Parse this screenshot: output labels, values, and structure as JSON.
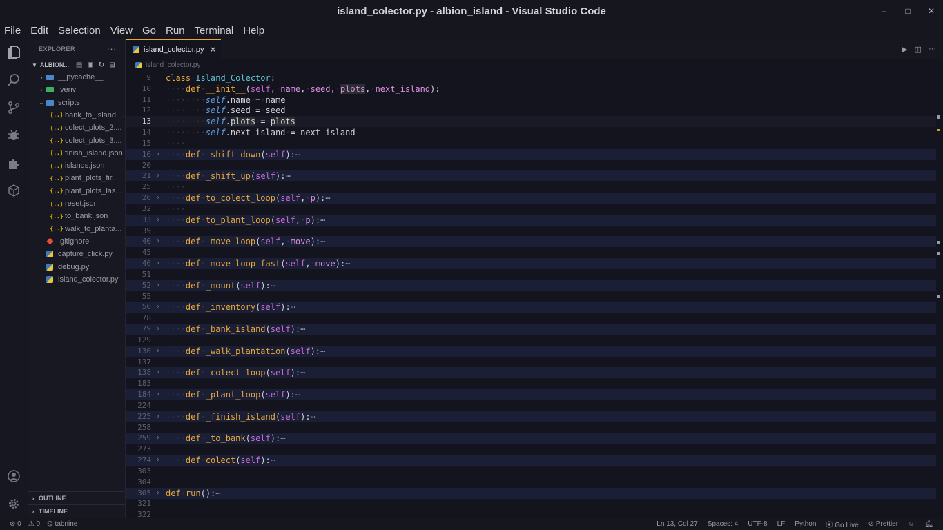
{
  "window": {
    "title": "island_colector.py - albion_island - Visual Studio Code",
    "minimize": "–",
    "maximize": "□",
    "close": "✕"
  },
  "menu": [
    "File",
    "Edit",
    "Selection",
    "View",
    "Go",
    "Run",
    "Terminal",
    "Help"
  ],
  "explorer": {
    "header": "EXPLORER",
    "more": "···",
    "folder": "ALBION...",
    "items": [
      {
        "label": "__pycache__",
        "type": "folder",
        "depth": 1
      },
      {
        "label": ".venv",
        "type": "folder",
        "depth": 1
      },
      {
        "label": "scripts",
        "type": "folder-open",
        "depth": 1
      },
      {
        "label": "bank_to_island....",
        "type": "json",
        "depth": 2
      },
      {
        "label": "colect_plots_2....",
        "type": "json",
        "depth": 2
      },
      {
        "label": "colect_plots_3....",
        "type": "json",
        "depth": 2
      },
      {
        "label": "finish_island.json",
        "type": "json",
        "depth": 2
      },
      {
        "label": "islands.json",
        "type": "json",
        "depth": 2
      },
      {
        "label": "plant_plots_fir...",
        "type": "json",
        "depth": 2
      },
      {
        "label": "plant_plots_las...",
        "type": "json",
        "depth": 2
      },
      {
        "label": "reset.json",
        "type": "json",
        "depth": 2
      },
      {
        "label": "to_bank.json",
        "type": "json",
        "depth": 2
      },
      {
        "label": "walk_to_planta...",
        "type": "json",
        "depth": 2
      },
      {
        "label": ".gitignore",
        "type": "git",
        "depth": 1
      },
      {
        "label": "capture_click.py",
        "type": "py",
        "depth": 1
      },
      {
        "label": "debug.py",
        "type": "py",
        "depth": 1
      },
      {
        "label": "island_colector.py",
        "type": "py",
        "depth": 1
      }
    ],
    "outline": "OUTLINE",
    "timeline": "TIMELINE"
  },
  "tab": {
    "label": "island_colector.py",
    "close": "✕"
  },
  "breadcrumb": "island_colector.py",
  "editor": {
    "lines": [
      {
        "n": "9",
        "html": "<span class='kw'>class</span><span class='w'>·</span><span class='cls'>Island_Colector</span><span class='pl'>:</span>"
      },
      {
        "n": "10",
        "html": "<span class='w'>····</span><span class='kw'>def</span><span class='w'>·</span><span class='fn'>__init__</span><span class='pl'>(</span><span class='slf'>self</span><span class='pl'>,</span><span class='w'>·</span><span class='prm'>name</span><span class='pl'>,</span><span class='w'>·</span><span class='prm'>seed</span><span class='pl'>,</span><span class='w'>·</span><span class='prm hlword'>plots</span><span class='pl'>,</span><span class='w'>·</span><span class='prm'>next_island</span><span class='pl'>):</span>"
      },
      {
        "n": "11",
        "html": "<span class='w'>········</span><span class='it'>self</span><span class='pl'>.name</span><span class='w'>·</span><span class='pl'>=</span><span class='w'>·</span><span class='pl'>name</span>"
      },
      {
        "n": "12",
        "html": "<span class='w'>········</span><span class='it'>self</span><span class='pl'>.seed</span><span class='w'>·</span><span class='pl'>=</span><span class='w'>·</span><span class='pl'>seed</span>"
      },
      {
        "n": "13",
        "cur": true,
        "html": "<span class='w'>········</span><span class='it'>self</span><span class='pl'>.</span><span class='pl hlword'>plots</span><span class='w'>·</span><span class='pl'>=</span><span class='w'>·</span><span class='pl hlword'>plots</span>"
      },
      {
        "n": "14",
        "html": "<span class='w'>········</span><span class='it'>self</span><span class='pl'>.next_island</span><span class='w'>·</span><span class='pl'>=</span><span class='w'>·</span><span class='pl'>next_island</span>"
      },
      {
        "n": "15",
        "html": "<span class='w'>····</span>"
      },
      {
        "n": "16",
        "fold": true,
        "hl": true,
        "html": "<span class='w'>····</span><span class='kw'>def</span><span class='w'>·</span><span class='fn'>_shift_down</span><span class='pl'>(</span><span class='slf'>self</span><span class='pl'>):</span><span class='ell'>⋯</span>"
      },
      {
        "n": "20",
        "html": ""
      },
      {
        "n": "21",
        "fold": true,
        "hl": true,
        "html": "<span class='w'>····</span><span class='kw'>def</span><span class='w'>·</span><span class='fn'>_shift_up</span><span class='pl'>(</span><span class='slf'>self</span><span class='pl'>):</span><span class='ell'>⋯</span>"
      },
      {
        "n": "25",
        "html": "<span class='w'>····</span>"
      },
      {
        "n": "26",
        "fold": true,
        "hl": true,
        "html": "<span class='w'>····</span><span class='kw'>def</span><span class='w'>·</span><span class='fn'>to_colect_loop</span><span class='pl'>(</span><span class='slf'>self</span><span class='pl'>,</span><span class='w'>·</span><span class='prm'>p</span><span class='pl'>):</span><span class='ell'>⋯</span>"
      },
      {
        "n": "32",
        "html": "<span class='w'>····</span>"
      },
      {
        "n": "33",
        "fold": true,
        "hl": true,
        "html": "<span class='w'>····</span><span class='kw'>def</span><span class='w'>·</span><span class='fn'>to_plant_loop</span><span class='pl'>(</span><span class='slf'>self</span><span class='pl'>,</span><span class='w'>·</span><span class='prm'>p</span><span class='pl'>):</span><span class='ell'>⋯</span>"
      },
      {
        "n": "39",
        "html": ""
      },
      {
        "n": "40",
        "fold": true,
        "hl": true,
        "html": "<span class='w'>····</span><span class='kw'>def</span><span class='w'>·</span><span class='fn'>_move_loop</span><span class='pl'>(</span><span class='slf'>self</span><span class='pl'>,</span><span class='w'>·</span><span class='prm'>move</span><span class='pl'>):</span><span class='ell'>⋯</span>"
      },
      {
        "n": "45",
        "html": ""
      },
      {
        "n": "46",
        "fold": true,
        "hl": true,
        "html": "<span class='w'>····</span><span class='kw'>def</span><span class='w'>·</span><span class='fn'>_move_loop_fast</span><span class='pl'>(</span><span class='slf'>self</span><span class='pl'>,</span><span class='w'>·</span><span class='prm'>move</span><span class='pl'>):</span><span class='ell'>⋯</span>"
      },
      {
        "n": "51",
        "html": ""
      },
      {
        "n": "52",
        "fold": true,
        "hl": true,
        "html": "<span class='w'>····</span><span class='kw'>def</span><span class='w'>·</span><span class='fn'>_mount</span><span class='pl'>(</span><span class='slf'>self</span><span class='pl'>):</span><span class='ell'>⋯</span>"
      },
      {
        "n": "55",
        "html": ""
      },
      {
        "n": "56",
        "fold": true,
        "hl": true,
        "html": "<span class='w'>····</span><span class='kw'>def</span><span class='w'>·</span><span class='fn'>_inventory</span><span class='pl'>(</span><span class='slf'>self</span><span class='pl'>):</span><span class='ell'>⋯</span>"
      },
      {
        "n": "78",
        "html": ""
      },
      {
        "n": "79",
        "fold": true,
        "hl": true,
        "html": "<span class='w'>····</span><span class='kw'>def</span><span class='w'>·</span><span class='fn'>_bank_island</span><span class='pl'>(</span><span class='slf'>self</span><span class='pl'>):</span><span class='ell'>⋯</span>"
      },
      {
        "n": "129",
        "html": ""
      },
      {
        "n": "130",
        "fold": true,
        "hl": true,
        "html": "<span class='w'>····</span><span class='kw'>def</span><span class='w'>·</span><span class='fn'>_walk_plantation</span><span class='pl'>(</span><span class='slf'>self</span><span class='pl'>):</span><span class='ell'>⋯</span>"
      },
      {
        "n": "137",
        "html": ""
      },
      {
        "n": "138",
        "fold": true,
        "hl": true,
        "html": "<span class='w'>····</span><span class='kw'>def</span><span class='w'>·</span><span class='fn'>_colect_loop</span><span class='pl'>(</span><span class='slf'>self</span><span class='pl'>):</span><span class='ell'>⋯</span>"
      },
      {
        "n": "183",
        "html": ""
      },
      {
        "n": "184",
        "fold": true,
        "hl": true,
        "html": "<span class='w'>····</span><span class='kw'>def</span><span class='w'>·</span><span class='fn'>_plant_loop</span><span class='pl'>(</span><span class='slf'>self</span><span class='pl'>):</span><span class='ell'>⋯</span>"
      },
      {
        "n": "224",
        "html": ""
      },
      {
        "n": "225",
        "fold": true,
        "hl": true,
        "html": "<span class='w'>····</span><span class='kw'>def</span><span class='w'>·</span><span class='fn'>_finish_island</span><span class='pl'>(</span><span class='slf'>self</span><span class='pl'>):</span><span class='ell'>⋯</span>"
      },
      {
        "n": "258",
        "html": ""
      },
      {
        "n": "259",
        "fold": true,
        "hl": true,
        "html": "<span class='w'>····</span><span class='kw'>def</span><span class='w'>·</span><span class='fn'>_to_bank</span><span class='pl'>(</span><span class='slf'>self</span><span class='pl'>):</span><span class='ell'>⋯</span>"
      },
      {
        "n": "273",
        "html": ""
      },
      {
        "n": "274",
        "fold": true,
        "hl": true,
        "html": "<span class='w'>····</span><span class='kw'>def</span><span class='w'>·</span><span class='fn'>colect</span><span class='pl'>(</span><span class='slf'>self</span><span class='pl'>):</span><span class='ell'>⋯</span>"
      },
      {
        "n": "303",
        "html": ""
      },
      {
        "n": "304",
        "html": ""
      },
      {
        "n": "305",
        "fold": true,
        "hl": true,
        "html": "<span class='kw'>def</span><span class='w'>·</span><span class='fn'>run</span><span class='pl'>():</span><span class='ell'>⋯</span>"
      },
      {
        "n": "321",
        "html": ""
      },
      {
        "n": "322",
        "html": ""
      }
    ]
  },
  "status": {
    "errors": "⊗ 0",
    "warnings": "⚠ 0",
    "tabnine": "⌬ tabnine",
    "position": "Ln 13, Col 27",
    "spaces": "Spaces: 4",
    "encoding": "UTF-8",
    "eol": "LF",
    "language": "Python",
    "golive": "Go Live",
    "prettier": "Prettier"
  }
}
